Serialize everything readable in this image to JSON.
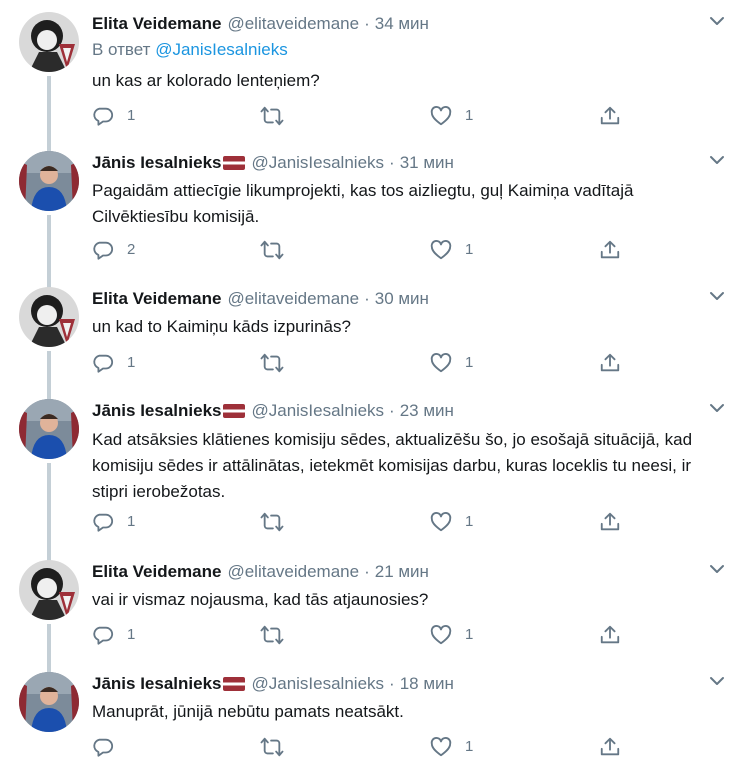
{
  "colors": {
    "text": "#14171a",
    "secondary": "#657786",
    "link": "#1b95e0",
    "connector": "#c4cfd6",
    "icon": "#657786"
  },
  "tweets": [
    {
      "name": "Elita Veidemane",
      "handle": "@elitaveidemane",
      "dot": "·",
      "time": "34 мин",
      "replying_label": "В ответ",
      "replying_to": "@JanisIesalnieks",
      "text": "un kas ar kolorado lenteņiem?",
      "reply_count": "1",
      "retweet_count": "",
      "like_count": "1",
      "avatar": "elita",
      "has_flag": false
    },
    {
      "name": "Jānis Iesalnieks",
      "handle": "@JanisIesalnieks",
      "dot": "·",
      "time": "31 мин",
      "text": "Pagaidām attiecīgie likumprojekti, kas tos aizliegtu, guļ Kaimiņa vadītajā Cilvēktiesību komisijā.",
      "reply_count": "2",
      "retweet_count": "",
      "like_count": "1",
      "avatar": "janis",
      "has_flag": true
    },
    {
      "name": "Elita Veidemane",
      "handle": "@elitaveidemane",
      "dot": "·",
      "time": "30 мин",
      "text": "un kad to Kaimiņu kāds izpurinās?",
      "reply_count": "1",
      "retweet_count": "",
      "like_count": "1",
      "avatar": "elita",
      "has_flag": false
    },
    {
      "name": "Jānis Iesalnieks",
      "handle": "@JanisIesalnieks",
      "dot": "·",
      "time": "23 мин",
      "text": "Kad atsāksies klātienes komisiju sēdes, aktualizēšu šo, jo esošajā situācijā, kad komisiju sēdes ir attālinātas, ietekmēt komisijas darbu, kuras loceklis tu neesi, ir stipri ierobežotas.",
      "reply_count": "1",
      "retweet_count": "",
      "like_count": "1",
      "avatar": "janis",
      "has_flag": true
    },
    {
      "name": "Elita Veidemane",
      "handle": "@elitaveidemane",
      "dot": "·",
      "time": "21 мин",
      "text": "vai ir vismaz nojausma, kad tās atjaunosies?",
      "reply_count": "1",
      "retweet_count": "",
      "like_count": "1",
      "avatar": "elita",
      "has_flag": false
    },
    {
      "name": "Jānis Iesalnieks",
      "handle": "@JanisIesalnieks",
      "dot": "·",
      "time": "18 мин",
      "text": "Manuprāt, jūnijā nebūtu pamats neatsākt.",
      "reply_count": "",
      "retweet_count": "",
      "like_count": "1",
      "avatar": "janis",
      "has_flag": true
    }
  ]
}
